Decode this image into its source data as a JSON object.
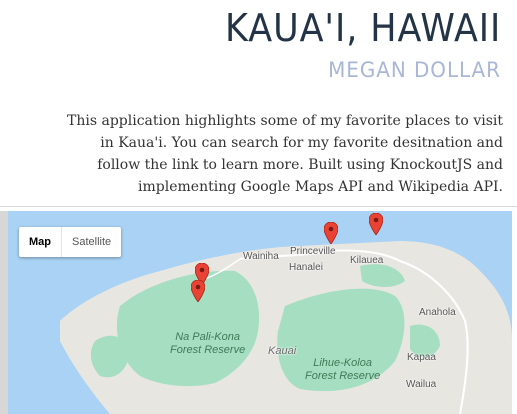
{
  "header": {
    "title": "KAUA'I, HAWAII",
    "subtitle": "MEGAN DOLLAR",
    "description": "This application highlights some of my favorite places to visit in Kaua'i. You can search for my favorite desitnation and follow the link to learn more. Built using KnockoutJS and implementing Google Maps API and Wikipedia API."
  },
  "map": {
    "type_controls": [
      "Map",
      "Satellite"
    ],
    "selected_type": "Map",
    "labels": {
      "wainiha": "Wainiha",
      "princeville": "Princeville",
      "hanalei": "Hanalei",
      "kilauea": "Kilauea",
      "anahola": "Anahola",
      "kauai": "Kauai",
      "kapaa": "Kapaa",
      "wailua": "Wailua"
    },
    "forests": {
      "napali": [
        "Na Pali-Kona",
        "Forest Reserve"
      ],
      "lihue": [
        "Lihue-Koloa",
        "Forest Reserve"
      ]
    },
    "colors": {
      "water": "#a9d2f4",
      "land": "#e8e6e1",
      "park": "#a6dec2",
      "marker": "#ea4335"
    }
  }
}
